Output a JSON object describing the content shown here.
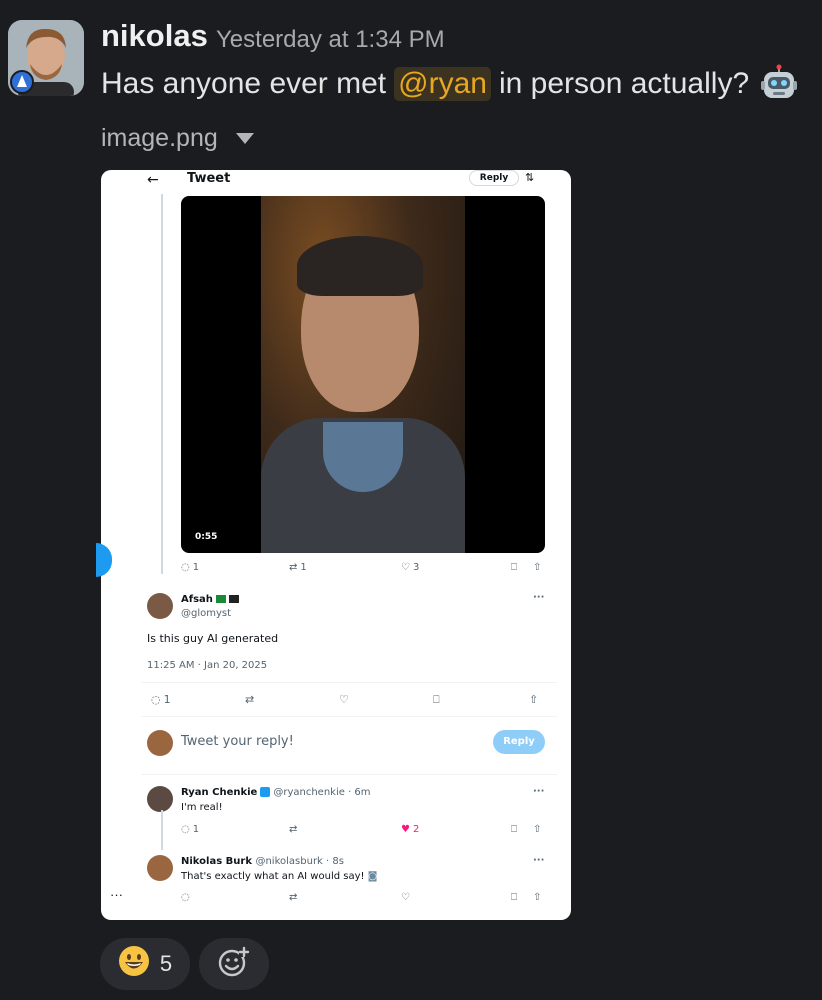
{
  "message": {
    "author": "nikolas",
    "timestamp": "Yesterday at 1:34 PM",
    "text_before": "Has anyone ever met",
    "mention": "@ryan",
    "text_after": "in person actually?",
    "emoji_icon": "robot-face-icon"
  },
  "attachment": {
    "filename": "image.png"
  },
  "tweet": {
    "back_icon": "arrow-left-icon",
    "title": "Tweet",
    "reply_button": "Reply",
    "video_duration": "0:55",
    "actions": {
      "replies": "1",
      "retweets": "1",
      "likes": "3"
    },
    "reply": {
      "author": "Afsah",
      "handle": "@glomyst",
      "text": "Is this guy AI generated",
      "time": "11:25 AM · Jan 20, 2025",
      "replies": "1"
    },
    "compose": {
      "placeholder": "Tweet your reply!",
      "button": "Reply"
    },
    "comments": [
      {
        "author": "Ryan Chenkie",
        "handle": "@ryanchenkie · 6m",
        "text": "I'm real!",
        "replies": "1",
        "likes": "2"
      },
      {
        "author": "Nikolas Burk",
        "handle": "@nikolasburk · 8s",
        "text": "That's exactly what an AI would say!"
      }
    ],
    "more": "···"
  },
  "reactions": [
    {
      "emoji_icon": "grinning-face-icon",
      "count": "5"
    }
  ],
  "colors": {
    "background": "#1b1c20",
    "mention_bg": "#3b3320",
    "mention_fg": "#e8a723",
    "twitter_blue": "#1d9bf0",
    "like_pink": "#f91880"
  }
}
